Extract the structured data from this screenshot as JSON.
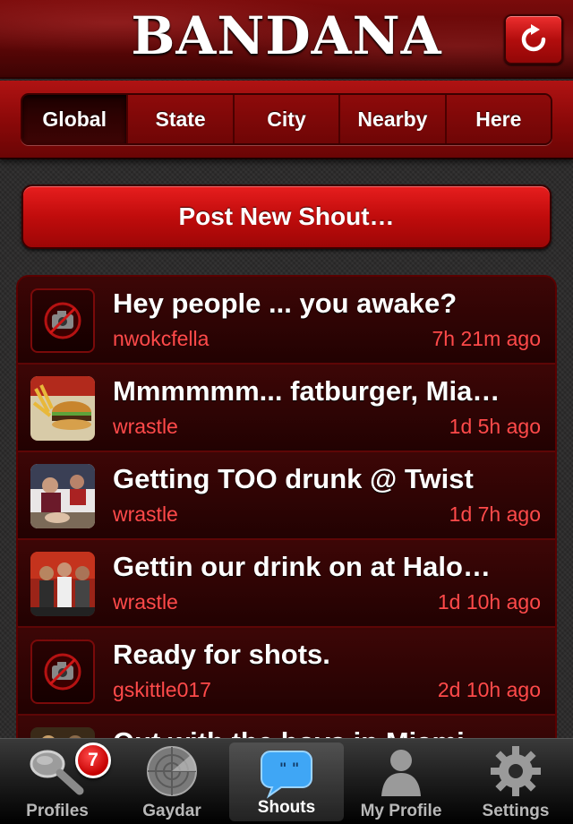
{
  "app": {
    "title": "BANDANA"
  },
  "header": {
    "refresh_icon": "refresh-icon"
  },
  "scope_tabs": [
    {
      "label": "Global",
      "active": true
    },
    {
      "label": "State",
      "active": false
    },
    {
      "label": "City",
      "active": false
    },
    {
      "label": "Nearby",
      "active": false
    },
    {
      "label": "Here",
      "active": false
    }
  ],
  "post_button": {
    "label": "Post New Shout…"
  },
  "shouts": [
    {
      "title": "Hey people ... you awake?",
      "user": "nwokcfella",
      "time": "7h 21m ago",
      "thumb": "no-photo"
    },
    {
      "title": "Mmmmmm... fatburger, Mia…",
      "user": "wrastle",
      "time": "1d 5h ago",
      "thumb": "photo-burger"
    },
    {
      "title": "Getting TOO drunk @ Twist",
      "user": "wrastle",
      "time": "1d 7h ago",
      "thumb": "photo-party"
    },
    {
      "title": "Gettin our drink on at Halo…",
      "user": "wrastle",
      "time": "1d 10h ago",
      "thumb": "photo-friends"
    },
    {
      "title": "Ready for shots.",
      "user": "gskittle017",
      "time": "2d 10h ago",
      "thumb": "no-photo"
    },
    {
      "title": "Out with the boys in Miami",
      "user": "",
      "time": "",
      "thumb": "photo-boys"
    }
  ],
  "tabbar": {
    "items": [
      {
        "label": "Profiles",
        "icon": "magnifier-icon",
        "badge": "7"
      },
      {
        "label": "Gaydar",
        "icon": "radar-icon"
      },
      {
        "label": "Shouts",
        "icon": "speech-bubble-icon",
        "active": true
      },
      {
        "label": "My Profile",
        "icon": "person-icon"
      },
      {
        "label": "Settings",
        "icon": "gear-icon"
      }
    ]
  },
  "colors": {
    "accent": "#c00c0c",
    "meta_text": "#ff4a4a",
    "header": "#6a0505"
  }
}
